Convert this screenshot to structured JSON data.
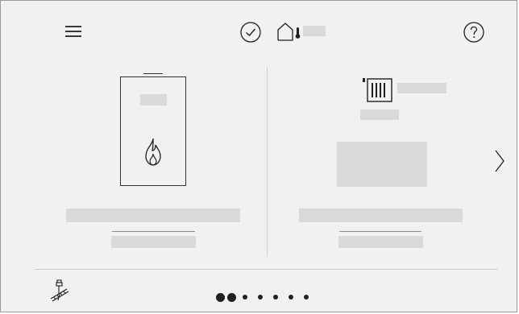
{
  "icons": {
    "menu": "menu-icon",
    "check": "check-circle-icon",
    "home_temp": "home-thermometer-icon",
    "help": "help-icon",
    "flame": "flame-icon",
    "radiator": "radiator-icon",
    "next": "chevron-right-icon",
    "chimney_sweep": "chimney-sweep-icon"
  },
  "colors": {
    "background": "#f1f1f1",
    "foreground": "#1f1f1f",
    "placeholder": "#d9d9d9",
    "divider": "#cfcfcf"
  },
  "pagination": {
    "total": 7,
    "current": 2
  }
}
